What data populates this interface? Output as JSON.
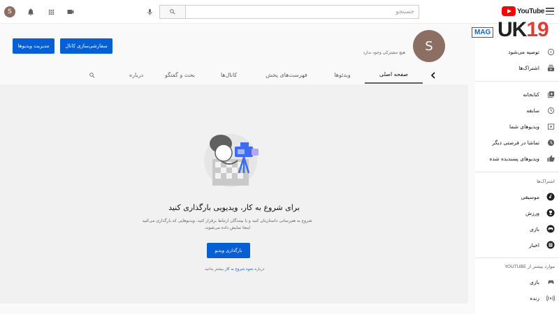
{
  "topbar": {
    "user_initial": "S",
    "search": {
      "placeholder": "جستجو",
      "value": ""
    },
    "logo_text": "YouTube",
    "icons": [
      "notifications-icon",
      "apps-icon",
      "create-video-icon",
      "mic-icon",
      "search-icon",
      "menu-icon"
    ]
  },
  "brand": {
    "mag": "MAG",
    "num_black": "UK",
    "num_red": "19"
  },
  "channel": {
    "avatar_initial": "S",
    "subscribers": "هیچ مشترکی وجود ندارد",
    "customize_button": "سفارشی‌سازی کانال",
    "manage_button": "مدیریت ویدیوها"
  },
  "tabs": [
    {
      "label": "صفحه اصلی",
      "active": true
    },
    {
      "label": "ویدئوها",
      "active": false
    },
    {
      "label": "فهرست‌های پخش",
      "active": false
    },
    {
      "label": "کانال‌ها",
      "active": false
    },
    {
      "label": "بحث و گفتگو",
      "active": false
    },
    {
      "label": "درباره",
      "active": false
    }
  ],
  "empty_state": {
    "headline": "برای شروع به کار، ویدیویی بارگذاری کنید",
    "description_line1": "شروع به هم‌رسانی داستان‌تان کنید و با بینندگان ارتباط برقرار کنید. ویدیوهایی که بارگذاری می‌کنید",
    "description_line2": "اینجا نمایش داده می‌شوند.",
    "upload_button": "بارگذاری ویدیو",
    "learn_prefix": "درباره",
    "learn_link": "نحوه شروع به کار",
    "learn_suffix": "بیشتر بدانید."
  },
  "sidebar": {
    "items_top": [
      {
        "label": "توصیه می‌شود",
        "icon": "explore-icon"
      },
      {
        "label": "اشتراک‌ها",
        "icon": "subscriptions-icon"
      }
    ],
    "items_library": [
      {
        "label": "کتابخانه",
        "icon": "library-icon"
      },
      {
        "label": "سابقه",
        "icon": "history-icon"
      },
      {
        "label": "ویدیوهای شما",
        "icon": "your-videos-icon"
      },
      {
        "label": "تماشا در فرصتی دیگر",
        "icon": "watch-later-icon"
      },
      {
        "label": "ویدیوهای پسندیده شده",
        "icon": "liked-icon"
      }
    ],
    "subscriptions_heading": "اشتراک‌ها",
    "subscriptions": [
      {
        "label": "موسیقی",
        "icon": "music-icon"
      },
      {
        "label": "ورزش",
        "icon": "sports-icon"
      },
      {
        "label": "بازی",
        "icon": "gaming-icon"
      },
      {
        "label": "اخبار",
        "icon": "news-icon"
      }
    ],
    "more_heading": "موارد بیشتر از YOUTUBE",
    "more": [
      {
        "label": "بازی",
        "icon": "gaming-icon"
      },
      {
        "label": "زنده",
        "icon": "live-icon"
      }
    ]
  },
  "colors": {
    "accent": "#065fd4",
    "brand_red": "#ff0000",
    "avatar": "#8d6e63"
  }
}
